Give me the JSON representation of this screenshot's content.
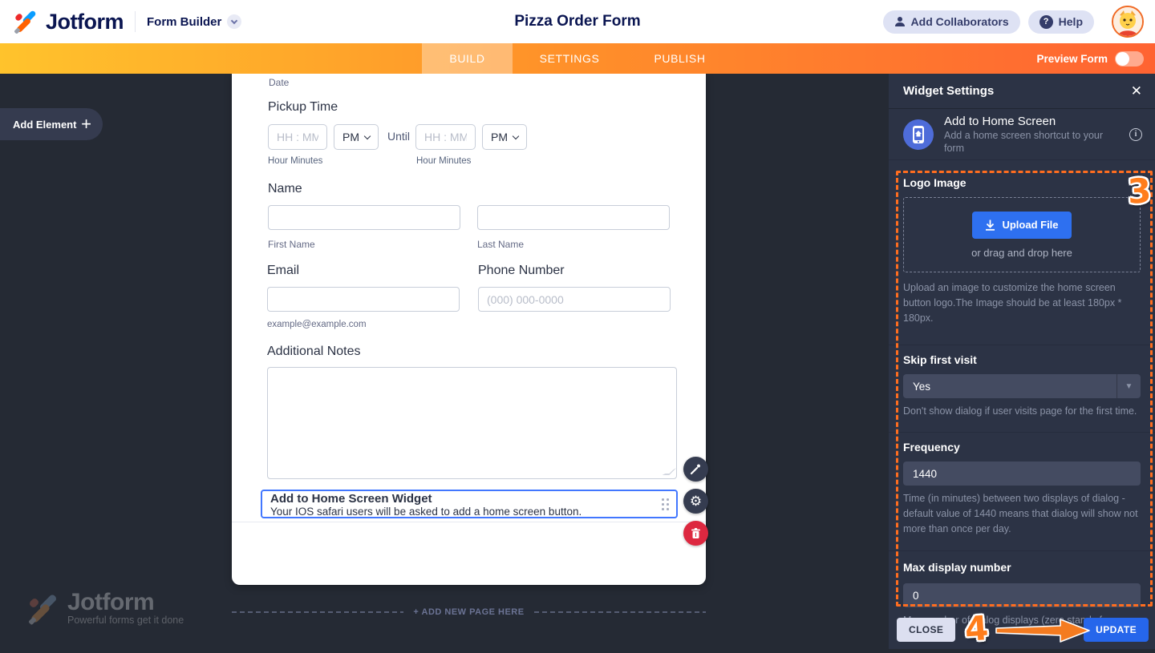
{
  "header": {
    "logo_text": "Jotform",
    "product_label": "Form Builder",
    "form_title": "Pizza Order Form",
    "add_collaborators_label": "Add Collaborators",
    "help_label": "Help",
    "help_q": "?"
  },
  "navbar": {
    "tabs": [
      {
        "label": "BUILD",
        "active": true
      },
      {
        "label": "SETTINGS",
        "active": false
      },
      {
        "label": "PUBLISH",
        "active": false
      }
    ],
    "preview_label": "Preview Form"
  },
  "canvas": {
    "add_element_label": "Add Element",
    "add_element_plus": "+",
    "add_new_page_label": "+ ADD NEW PAGE HERE",
    "watermark_title": "Jotform",
    "watermark_tagline": "Powerful forms get it done"
  },
  "form": {
    "date_label": "Date",
    "pickup_time": {
      "label": "Pickup Time",
      "time_placeholder": "HH : MM",
      "ampm_value": "PM",
      "until_label": "Until",
      "sublabel": "Hour Minutes"
    },
    "name": {
      "label": "Name",
      "first_sublabel": "First Name",
      "last_sublabel": "Last Name"
    },
    "email": {
      "label": "Email",
      "sublabel": "example@example.com"
    },
    "phone": {
      "label": "Phone Number",
      "placeholder": "(000) 000-0000"
    },
    "notes": {
      "label": "Additional Notes"
    },
    "widget": {
      "title": "Add to Home Screen Widget",
      "description": "Your IOS safari users will be asked to add a home screen button."
    }
  },
  "panel": {
    "title": "Widget Settings",
    "close_x": "✕",
    "widget_name": "Add to Home Screen",
    "widget_description": "Add a home screen shortcut to your form",
    "info_glyph": "i",
    "logo_image": {
      "label": "Logo Image",
      "upload_button": "Upload File",
      "drop_hint": "or drag and drop here",
      "helper": "Upload an image to customize the home screen button logo.The Image should be at least 180px * 180px."
    },
    "skip_first_visit": {
      "label": "Skip first visit",
      "value": "Yes",
      "arrow": "▼",
      "helper": "Don't show dialog if user visits page for the first time."
    },
    "frequency": {
      "label": "Frequency",
      "value": "1440",
      "helper": "Time (in minutes) between two displays of dialog - default value of 1440 means that dialog will show not more than once per day."
    },
    "max_display": {
      "label": "Max display number",
      "value": "0",
      "helper": "Max number of dialog displays (zero stands for no limit)."
    },
    "close_label": "CLOSE",
    "update_label": "UPDATE"
  },
  "annotations": {
    "step3": "3",
    "step4": "4"
  },
  "colors": {
    "accent_orange_start": "#ffc32c",
    "accent_orange_end": "#ff6332",
    "brand_navy": "#0a1551",
    "primary_blue": "#2e70f0",
    "panel_bg": "#2c3345",
    "annotation_orange": "#ff6d1f",
    "selected_border_blue": "#4277ff",
    "delete_red": "#dd2840"
  }
}
